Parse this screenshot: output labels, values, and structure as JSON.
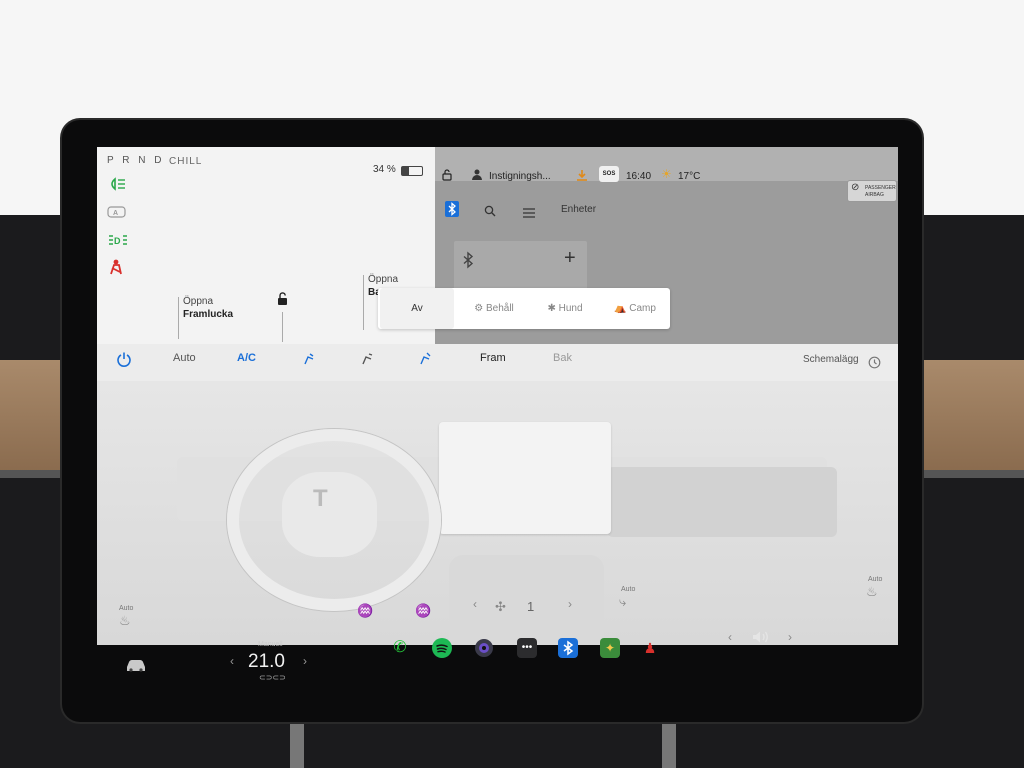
{
  "status": {
    "gears": "P R N D",
    "drive_mode": "CHILL",
    "battery": "34 %",
    "profile": "Instigningsh...",
    "time": "16:40",
    "temp_outside": "17°C",
    "sos": "SOS",
    "airbag_line1": "PASSENGER",
    "airbag_line2": "AIRBAG"
  },
  "doors": {
    "front_top": "Öppna",
    "front_bottom": "Framlucka",
    "rear_top": "Öppna",
    "rear_bottom": "Ba"
  },
  "bluetooth": {
    "tab_label": "Enheter"
  },
  "dog_mode_menu": [
    {
      "label": "Av",
      "selected": true
    },
    {
      "label": "Behåll",
      "selected": false
    },
    {
      "label": "Hund",
      "selected": false
    },
    {
      "label": "Camp",
      "selected": false
    }
  ],
  "climate": {
    "auto": "Auto",
    "ac": "A/C",
    "front": "Fram",
    "rear": "Bak",
    "schedule": "Schemalägg"
  },
  "interior": {
    "left_seat_auto": "Auto",
    "right_seat_auto": "Auto",
    "fan_speed": "1",
    "recirc_auto": "Auto"
  },
  "dock": {
    "temp_mode": "Manuell",
    "temp": "21.0"
  },
  "colors": {
    "accent": "#1a6fd8",
    "green_indicator": "#2aa84a",
    "red_indicator": "#d9302c",
    "phone": "#25c43b",
    "spotify": "#1db954"
  }
}
